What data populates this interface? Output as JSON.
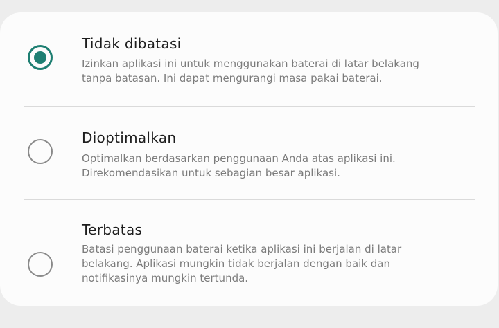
{
  "options": [
    {
      "title": "Tidak dibatasi",
      "description": "Izinkan aplikasi ini untuk menggunakan baterai di latar belakang tanpa batasan. Ini dapat mengurangi masa pakai baterai.",
      "selected": true
    },
    {
      "title": "Dioptimalkan",
      "description": "Optimalkan berdasarkan penggunaan Anda atas aplikasi ini. Direkomendasikan untuk sebagian besar aplikasi.",
      "selected": false
    },
    {
      "title": "Terbatas",
      "description": "Batasi penggunaan baterai ketika aplikasi ini berjalan di latar belakang. Aplikasi mungkin tidak berjalan dengan baik dan notifikasinya mungkin tertunda.",
      "selected": false
    }
  ],
  "colors": {
    "accent": "#1e7f72",
    "radio_unselected": "#8a8a8a",
    "title_text": "#1d1d1d",
    "description_text": "#7b7b7b",
    "card_background": "#fcfcfc",
    "page_background": "#ededed",
    "divider": "#dadada"
  }
}
